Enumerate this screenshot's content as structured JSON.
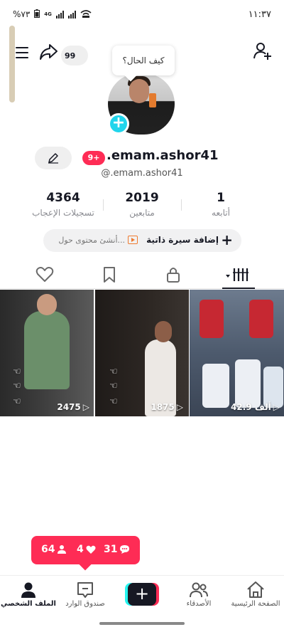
{
  "status_bar": {
    "time": "١١:٣٧",
    "battery": "%٧٣",
    "network": "4G"
  },
  "header": {
    "share_count": "99",
    "bubble_text": "كيف الحال؟"
  },
  "profile": {
    "display_name": ".emam.ashor41",
    "handle": "@.emam.ashor41",
    "notification_badge": "9+"
  },
  "stats": {
    "following": {
      "value": "1",
      "label": "أتابعه"
    },
    "followers": {
      "value": "2019",
      "label": "متابعين"
    },
    "likes": {
      "value": "4364",
      "label": "تسجيلات الإعجاب"
    }
  },
  "bio": {
    "add_bio_label": "إضافة سيرة ذاتية",
    "separator": "·",
    "create_content_label": "أنشئ محتوى حول..."
  },
  "videos": [
    {
      "views": "42.9 ألف"
    },
    {
      "views": "1875"
    },
    {
      "views": "2475"
    }
  ],
  "activity": {
    "followers": "64",
    "likes": "4",
    "comments": "31"
  },
  "bottom_nav": {
    "home": "الصفحة الرئيسية",
    "friends": "الأصدقاء",
    "create": "+",
    "inbox": "صندوق الوارد",
    "profile": "الملف الشخصي"
  },
  "colors": {
    "accent": "#fe2c55",
    "cyan": "#25f4ee",
    "text": "#161823"
  }
}
